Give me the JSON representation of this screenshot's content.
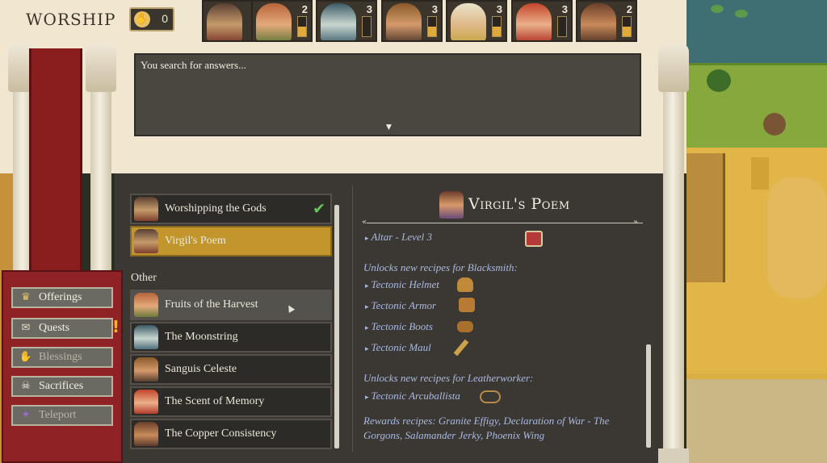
{
  "header": {
    "title": "WORSHIP",
    "favor_count": "0"
  },
  "gods": [
    {
      "level": "",
      "fill": 0.0
    },
    {
      "level": "2",
      "fill": 0.5
    },
    {
      "level": "3",
      "fill": 0.0
    },
    {
      "level": "3",
      "fill": 0.5
    },
    {
      "level": "3",
      "fill": 0.5
    },
    {
      "level": "3",
      "fill": 0.0
    },
    {
      "level": "2",
      "fill": 0.5
    }
  ],
  "dialog": {
    "text": "You search for answers...",
    "advance_icon": "▼"
  },
  "menu": {
    "items": [
      {
        "label": "Offerings",
        "icon": "offering-icon"
      },
      {
        "label": "Quests",
        "icon": "scroll-icon"
      },
      {
        "label": "Blessings",
        "icon": "blessing-icon"
      },
      {
        "label": "Sacrifices",
        "icon": "skull-icon"
      },
      {
        "label": "Teleport",
        "icon": "teleport-icon"
      }
    ]
  },
  "quests": {
    "items": [
      {
        "label": "Worshipping the Gods"
      },
      {
        "label": "Virgil's Poem"
      }
    ],
    "other_heading": "Other",
    "other_items": [
      {
        "label": "Fruits of the Harvest"
      },
      {
        "label": "The Moonstring"
      },
      {
        "label": "Sanguis Celeste"
      },
      {
        "label": "The Scent of Memory"
      },
      {
        "label": "The Copper Consistency"
      }
    ]
  },
  "detail": {
    "title": "Virgil's Poem",
    "requirement": "Altar - Level 3",
    "blacksmith_header": "Unlocks new recipes for Blacksmith:",
    "blacksmith_items": [
      "Tectonic Helmet",
      "Tectonic Armor",
      "Tectonic Boots",
      "Tectonic Maul"
    ],
    "leather_header": "Unlocks new recipes for Leatherworker:",
    "leather_items": [
      "Tectonic Arcuballista"
    ],
    "rewards": "Rewards recipes: Granite Effigy, Declaration of War - The Gorgons, Salamander Jerky, Phoenix Wing"
  },
  "colors": {
    "selected": "#c2962c",
    "menu_red": "#8f2225",
    "link_blue": "#a9b9e2"
  }
}
